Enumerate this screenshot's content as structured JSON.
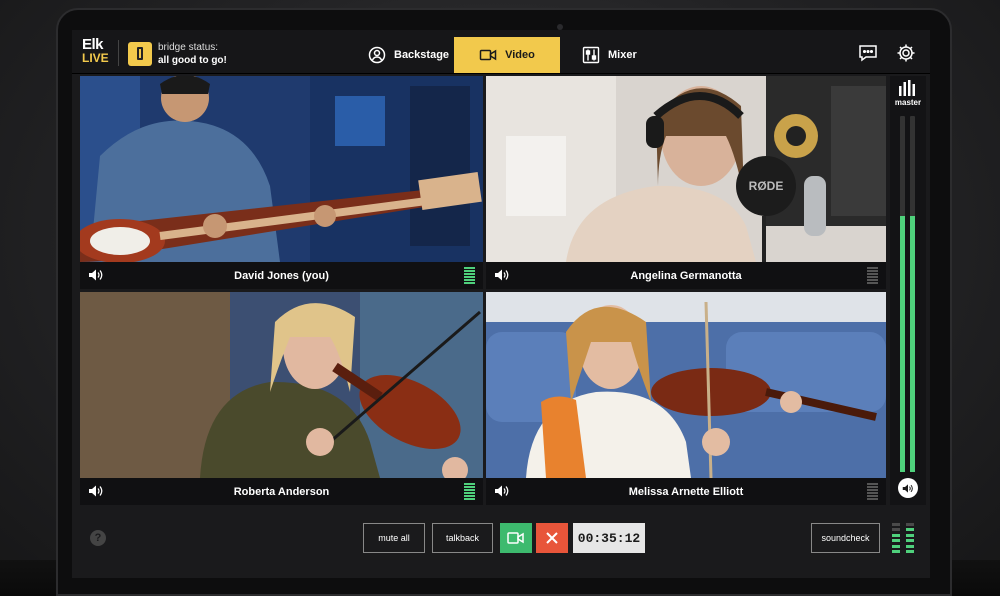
{
  "app": {
    "logo_line1": "Elk",
    "logo_line2": "LIVE"
  },
  "bridge": {
    "label": "bridge status:",
    "value": "all good to go!"
  },
  "tabs": [
    {
      "label": "Backstage",
      "icon": "person-icon",
      "active": false
    },
    {
      "label": "Video",
      "icon": "video-camera-icon",
      "active": true
    },
    {
      "label": "Mixer",
      "icon": "mixer-sliders-icon",
      "active": false
    }
  ],
  "participants": [
    {
      "name": "David Jones (you)",
      "level": 1.0
    },
    {
      "name": "Angelina Germanotta",
      "level": 0.0
    },
    {
      "name": "Roberta Anderson",
      "level": 1.0
    },
    {
      "name": "Melissa Arnette Elliott",
      "level": 0.0
    }
  ],
  "master": {
    "label": "master",
    "level_left": 0.72,
    "level_right": 0.72
  },
  "controls": {
    "mute_all": "mute all",
    "talkback": "talkback",
    "timer": "00:35:12",
    "soundcheck": "soundcheck",
    "help": "?"
  },
  "colors": {
    "accent": "#f2c94c",
    "meter_green": "#4fd17c",
    "camera_button": "#3dba6e",
    "end_button": "#e8553a"
  }
}
